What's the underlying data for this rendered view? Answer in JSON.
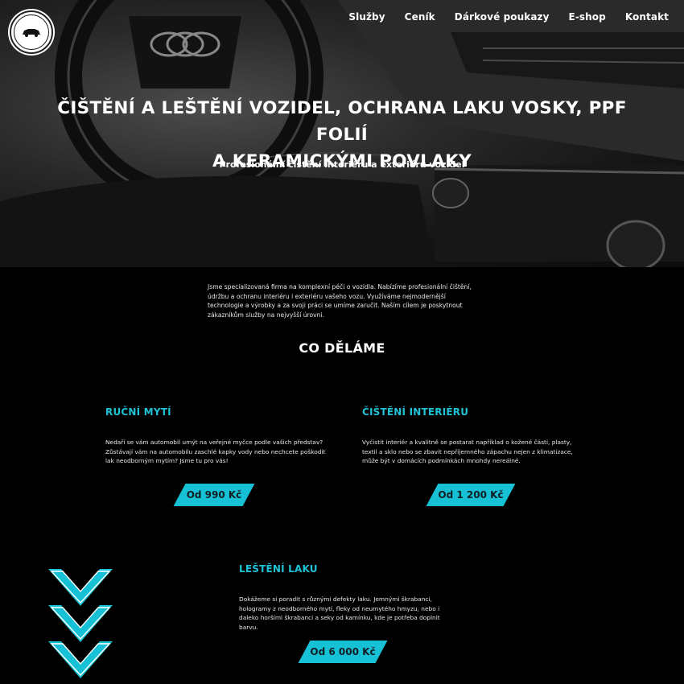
{
  "nav": {
    "items": [
      "Služby",
      "Ceník",
      "Dárkové poukazy",
      "E-shop",
      "Kontakt"
    ]
  },
  "hero": {
    "title_line1": "ČIŠTĚNÍ A LEŠTĚNÍ VOZIDEL, OCHRANA LAKU VOSKY, PPF FOLIÍ",
    "title_line2": "A KERAMICKÝMI POVLAKY",
    "subtitle": "Profesionální čištění interiéru a exteriéru vozidel"
  },
  "intro": "Jsme specializovaná firma na komplexní péči o vozidla. Nabízíme profesionální čištění, údržbu a ochranu interiéru i exteriéru vašeho vozu. Využíváme nejmodernější technologie a výrobky a za svoji práci se umíme zaručit. Naším cílem je poskytnout zákazníkům služby na nejvyšší úrovni.",
  "section_title": "CO DĚLÁME",
  "services": [
    {
      "title": "RUČNÍ MYTÍ",
      "text": "Nedaří se vám automobil umýt na veřejné myčce podle vašich představ? Zůstávají vám na automobilu zaschlé kapky vody nebo nechcete poškodit lak neodborným mytím? Jsme tu pro vás!",
      "price": "Od 990 Kč"
    },
    {
      "title": "ČIŠTĚNÍ INTERIÉRU",
      "text": "Vyčistit interiér a kvalitně se postarat například o kožené části, plasty, textil a sklo nebo se zbavit nepříjemného zápachu nejen z klimatizace, může být v domácích podmínkách mnohdy nereálné.",
      "price": "Od 1 200 Kč"
    },
    {
      "title": "LEŠTĚNÍ LAKU",
      "text": "Dokážeme si poradit s různými defekty laku. Jemnými škrabanci, hologramy z neodborného mytí, fleky od neumytého hmyzu, nebo i daleko horšími škrabanci a seky od kamínku, kde je potřeba doplnit barvu.",
      "price": "Od 6 000 Kč"
    }
  ],
  "colors": {
    "accent": "#16c1d6",
    "background": "#000000"
  },
  "icons": {
    "logo": "car-badge-logo",
    "decor": "chevron-down-stack-icon"
  }
}
